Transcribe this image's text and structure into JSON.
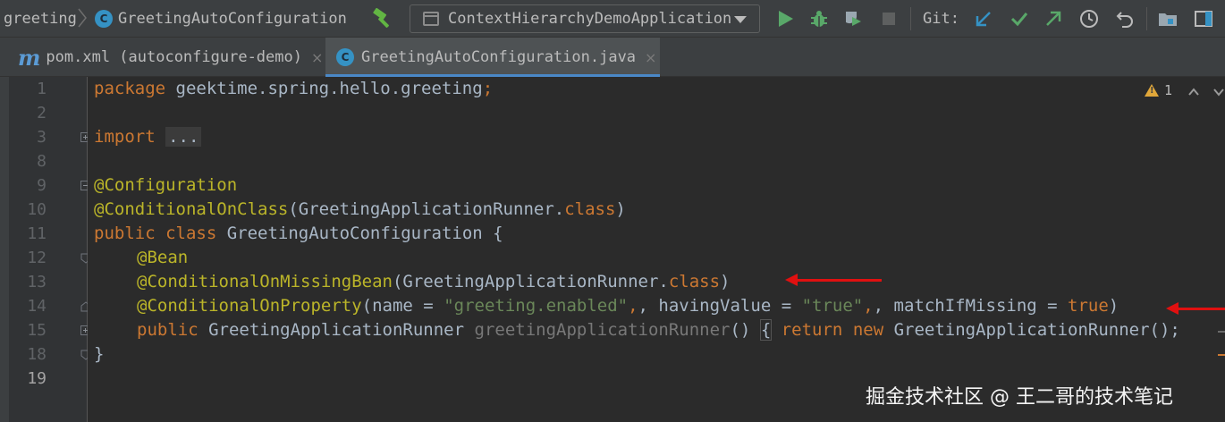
{
  "breadcrumb": {
    "project": "greeting",
    "class_name": "GreetingAutoConfiguration"
  },
  "toolbar": {
    "run_config": "ContextHierarchyDemoApplication",
    "git_label": "Git:"
  },
  "tabs": [
    {
      "label": "pom.xml (autoconfigure-demo)",
      "icon": "maven-icon",
      "active": false
    },
    {
      "label": "GreetingAutoConfiguration.java",
      "icon": "class-icon",
      "active": true
    }
  ],
  "tab_close": "×",
  "class_badge": "C",
  "maven_badge": "m",
  "warnings": {
    "count": "1"
  },
  "line_numbers": [
    "1",
    "2",
    "3",
    "8",
    "9",
    "10",
    "11",
    "12",
    "13",
    "14",
    "15",
    "18",
    "19"
  ],
  "code": {
    "l1_kw": "package",
    "l1_rest": " geektime.spring.hello.greeting",
    "l1_semi": ";",
    "l3_kw": "import",
    "l3_dots": "...",
    "l9_ann": "@Configuration",
    "l10_ann": "@ConditionalOnClass",
    "l10_open": "(GreetingApplicationRunner.",
    "l10_kw": "class",
    "l10_close": ")",
    "l11_kw1": "public",
    "l11_kw2": "class",
    "l11_rest": " GreetingAutoConfiguration {",
    "l12_ann": "@Bean",
    "l13_ann": "@ConditionalOnMissingBean",
    "l13_open": "(GreetingApplicationRunner.",
    "l13_kw": "class",
    "l13_close": ")",
    "l14_ann": "@ConditionalOnProperty",
    "l14_a": "(name = ",
    "l14_s1": "\"greeting.enabled\"",
    "l14_b": ", havingValue = ",
    "l14_s2": "\"true\"",
    "l14_c": ", matchIfMissing = ",
    "l14_kw": "true",
    "l14_d": ")",
    "l15_kw": "public",
    "l15_type": " GreetingApplicationRunner ",
    "l15_method": "greetingApplicationRunner",
    "l15_paren": "() ",
    "l15_brace": "{",
    "l15_ret": "return",
    "l15_new": "new",
    "l15_tail": " GreetingApplicationRunner();",
    "l18_brace": "}"
  },
  "watermark": "掘金技术社区 @ 王二哥的技术笔记",
  "colors": {
    "keyword": "#cc7832",
    "annotation": "#bbb529",
    "string": "#6a8759",
    "text": "#a9b7c6",
    "arrow": "#e01010",
    "tab_underline": "#4a88c7"
  }
}
